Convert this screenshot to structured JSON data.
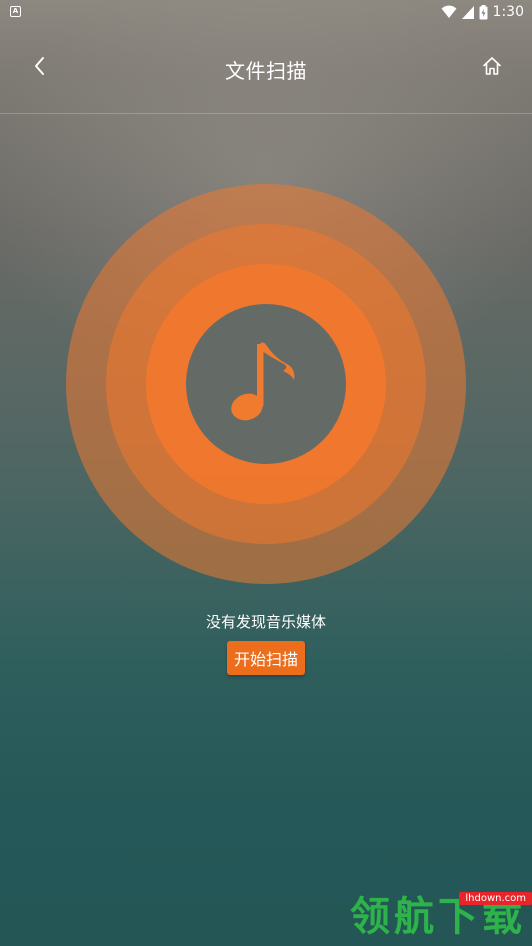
{
  "status_bar": {
    "time": "1:30",
    "app_icon_letter": "A",
    "icons": [
      "wifi-icon",
      "signal-icon",
      "battery-icon"
    ]
  },
  "header": {
    "title": "文件扫描",
    "back_icon": "chevron-left-icon",
    "home_icon": "home-icon"
  },
  "main": {
    "center_icon": "music-note-icon",
    "message": "没有发现音乐媒体",
    "scan_button_label": "开始扫描"
  },
  "watermark": {
    "badge": "lhdown.com",
    "text": "领航下载"
  },
  "colors": {
    "accent": "#ec6d1b",
    "ring": "#ef792f",
    "watermark_green": "#2db34a"
  }
}
